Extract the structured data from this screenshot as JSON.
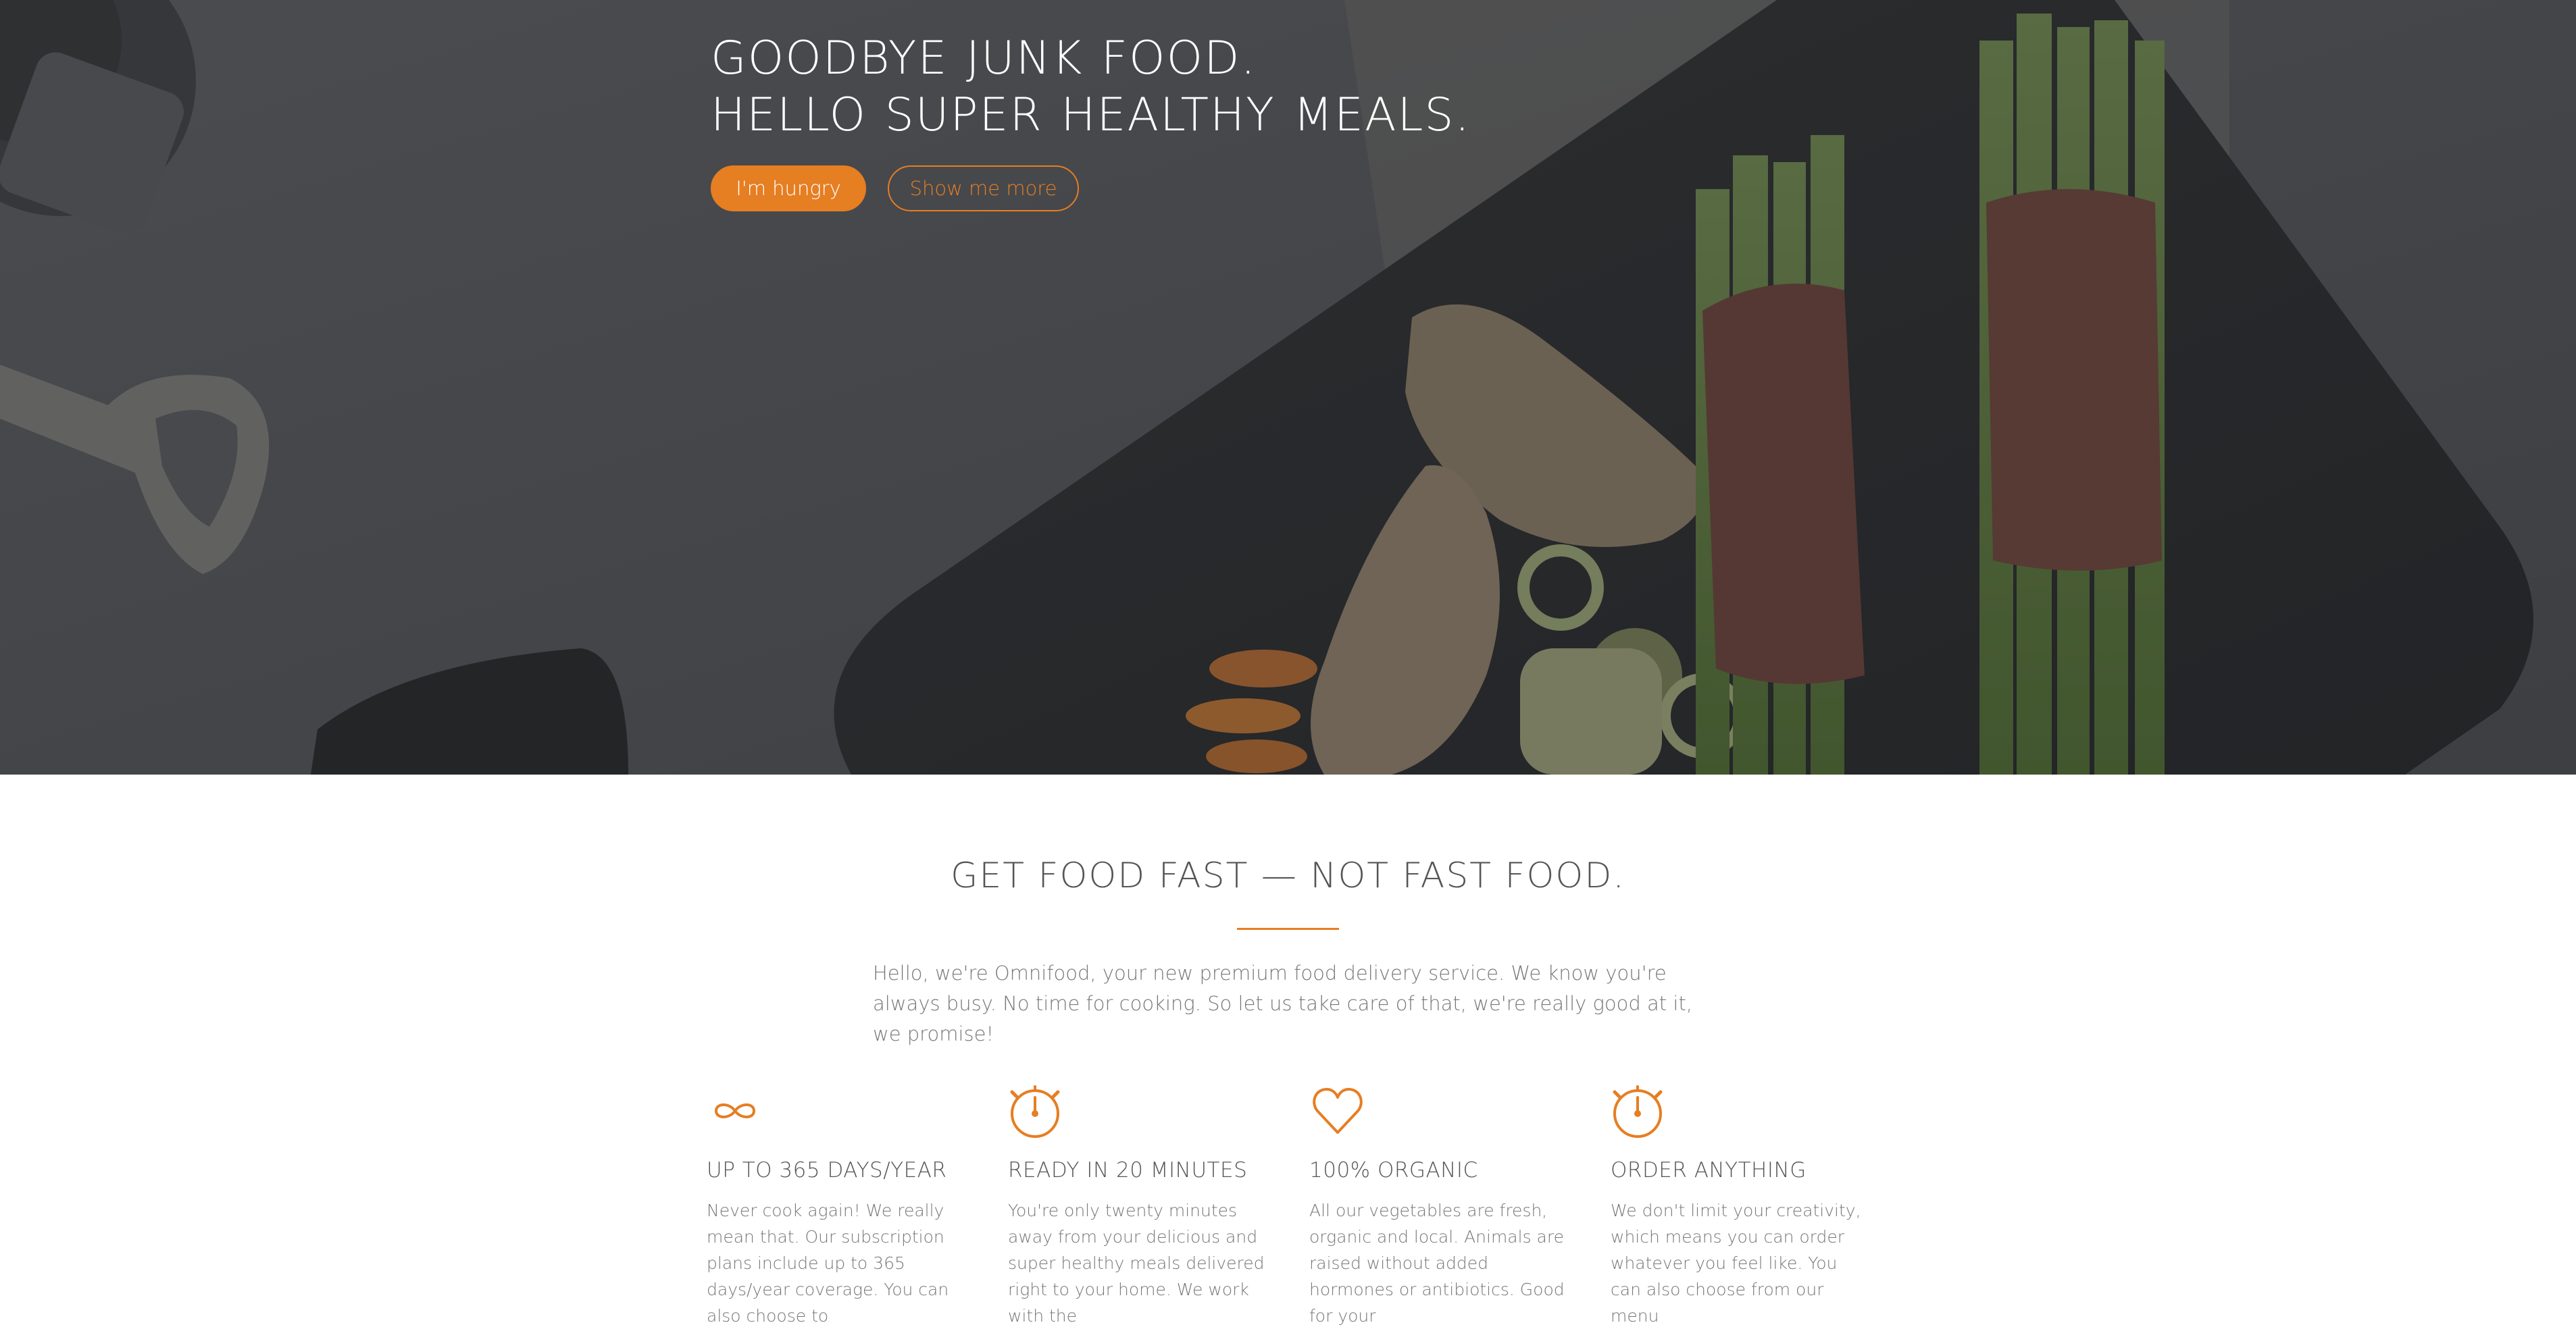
{
  "hero": {
    "title_line_1": "GOODBYE JUNK FOOD.",
    "title_line_2": "HELLO SUPER HEALTHY MEALS.",
    "primary_button": "I'm hungry",
    "secondary_button": "Show me more"
  },
  "features_section": {
    "title": "GET FOOD FAST — NOT FAST FOOD.",
    "intro": "Hello, we're Omnifood, your new premium food delivery service. We know you're always busy. No time for cooking. So let us take care of that, we're really good at it, we promise!",
    "items": [
      {
        "icon": "infinity-icon",
        "heading": "UP TO 365 DAYS/YEAR",
        "text": "Never cook again! We really mean that. Our subscription plans include up to 365 days/year coverage. You can also choose to"
      },
      {
        "icon": "stopwatch-icon",
        "heading": "READY IN 20 MINUTES",
        "text": "You're only twenty minutes away from your delicious and super healthy meals delivered right to your home. We work with the"
      },
      {
        "icon": "heart-icon",
        "heading": "100% ORGANIC",
        "text": "All our vegetables are fresh, organic and local. Animals are raised without added hormones or antibiotics. Good for your"
      },
      {
        "icon": "stopwatch-icon",
        "heading": "ORDER ANYTHING",
        "text": "We don't limit your creativity, which means you can order whatever you feel like. You can also choose from our menu"
      }
    ]
  },
  "colors": {
    "accent": "#e67e22",
    "hero_overlay": "#4a4b4f",
    "heading_text": "#555555",
    "body_text": "#777777"
  }
}
